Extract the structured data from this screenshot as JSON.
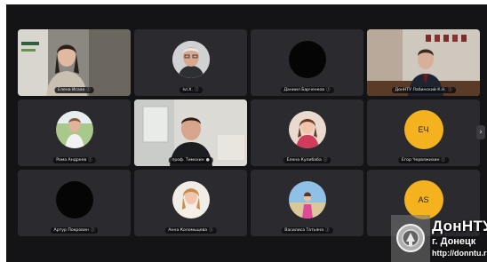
{
  "participants": [
    {
      "name": "Елена Исаак"
    },
    {
      "name": "Ivl.X."
    },
    {
      "name": "Даниил Барченков"
    },
    {
      "name": "ДонНТУ Лабинский К.Н."
    },
    {
      "name": "Рома Андреев"
    },
    {
      "name": "проф. Тимохин",
      "mic": "active"
    },
    {
      "name": "Елена Кулибаба"
    },
    {
      "name": "Егор Червяжихин",
      "initials": "ЕЧ"
    },
    {
      "name": "Артур Покровин"
    },
    {
      "name": "Анна Коломыцева"
    },
    {
      "name": "Василиса Татьяна"
    },
    {
      "name": "",
      "initials": "AS"
    }
  ],
  "watermark": {
    "title": "ДонНТУ",
    "city": "г. Донецк",
    "url": "http://donntu.r"
  },
  "colors": {
    "background": "#141416",
    "tile": "#2b2b2f",
    "active_speaker_border": "#3fbf6f",
    "initials_avatar": "#f4b21f"
  },
  "icons": {
    "mic": "mic-off-icon",
    "next_page": "chevron-right-icon"
  }
}
